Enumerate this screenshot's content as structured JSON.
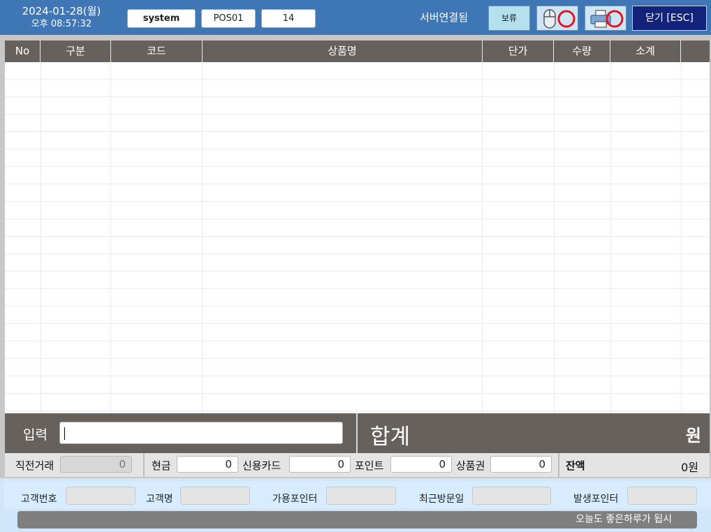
{
  "header": {
    "date": "2024-01-28(월)",
    "time": "오후 08:57:32",
    "user": "system",
    "pos_id": "POS01",
    "number": "14",
    "server_status": "서버연결됨",
    "hold_label": "보류",
    "close_label": "닫기 [ESC]",
    "mouse_icon": "mouse-icon",
    "printer_icon": "printer-icon",
    "status_color": "#e8141e"
  },
  "grid": {
    "columns": [
      "No",
      "구분",
      "코드",
      "상품명",
      "단가",
      "수량",
      "소계"
    ],
    "rows": []
  },
  "input": {
    "label": "입력",
    "value": "",
    "total_label": "합계",
    "total_amount": "원"
  },
  "payment": {
    "prev_label": "직전거래",
    "prev_value": "0",
    "cash_label": "현금",
    "cash_value": "0",
    "card_label": "신용카드",
    "card_value": "0",
    "point_label": "포인트",
    "point_value": "0",
    "voucher_label": "상품권",
    "voucher_value": "0",
    "balance_label": "잔액",
    "balance_value": "0원"
  },
  "customer": {
    "number_label": "고객번호",
    "number_value": "",
    "name_label": "고객명",
    "name_value": "",
    "available_points_label": "가용포인터",
    "available_points_value": "",
    "last_visit_label": "최근방문일",
    "last_visit_value": "",
    "earned_points_label": "발생포인터",
    "earned_points_value": "",
    "message": "오늘도 좋은하루가 됩시"
  }
}
